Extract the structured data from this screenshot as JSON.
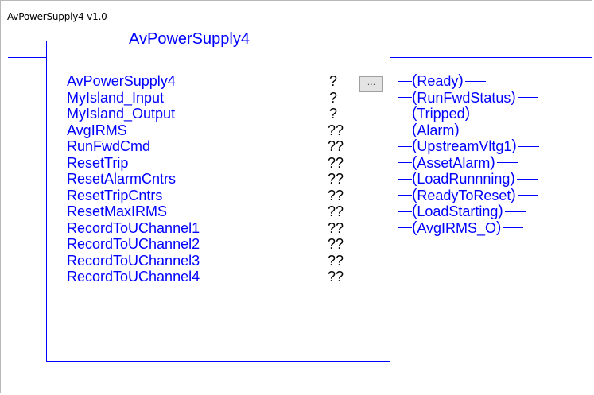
{
  "routine_title": "AvPowerSupply4 v1.0",
  "block": {
    "tag_name": "AvPowerSupply4",
    "ellipsis_label": "...",
    "parameters": [
      {
        "name": "AvPowerSupply4",
        "value": "?",
        "color": "#0000ff"
      },
      {
        "name": "MyIsland_Input",
        "value": "?",
        "color": "#0000ff"
      },
      {
        "name": "MyIsland_Output",
        "value": "?",
        "color": "#0000ff"
      },
      {
        "name": "AvgIRMS",
        "value": "??",
        "color": "#0000ff"
      },
      {
        "name": "RunFwdCmd",
        "value": "??",
        "color": "#0000ff"
      },
      {
        "name": "ResetTrip",
        "value": "??",
        "color": "#0000ff"
      },
      {
        "name": "ResetAlarmCntrs",
        "value": "??",
        "color": "#0000ff"
      },
      {
        "name": "ResetTripCntrs",
        "value": "??",
        "color": "#0000ff"
      },
      {
        "name": "ResetMaxIRMS",
        "value": "??",
        "color": "#0000ff"
      },
      {
        "name": "RecordToUChannel1",
        "value": "??",
        "color": "#0000ff"
      },
      {
        "name": "RecordToUChannel2",
        "value": "??",
        "color": "#0000ff"
      },
      {
        "name": "RecordToUChannel3",
        "value": "??",
        "color": "#0000ff"
      },
      {
        "name": "RecordToUChannel4",
        "value": "??",
        "color": "#0000ff"
      }
    ]
  },
  "output_coils": [
    "Ready",
    "RunFwdStatus",
    "Tripped",
    "Alarm",
    "UpstreamVltg1",
    "AssetAlarm",
    "LoadRunnning",
    "ReadyToReset",
    "LoadStarting",
    "AvgIRMS_O"
  ],
  "colors": {
    "wire": "#0000ff",
    "value_text": "#000000",
    "background": "#ffffff"
  }
}
